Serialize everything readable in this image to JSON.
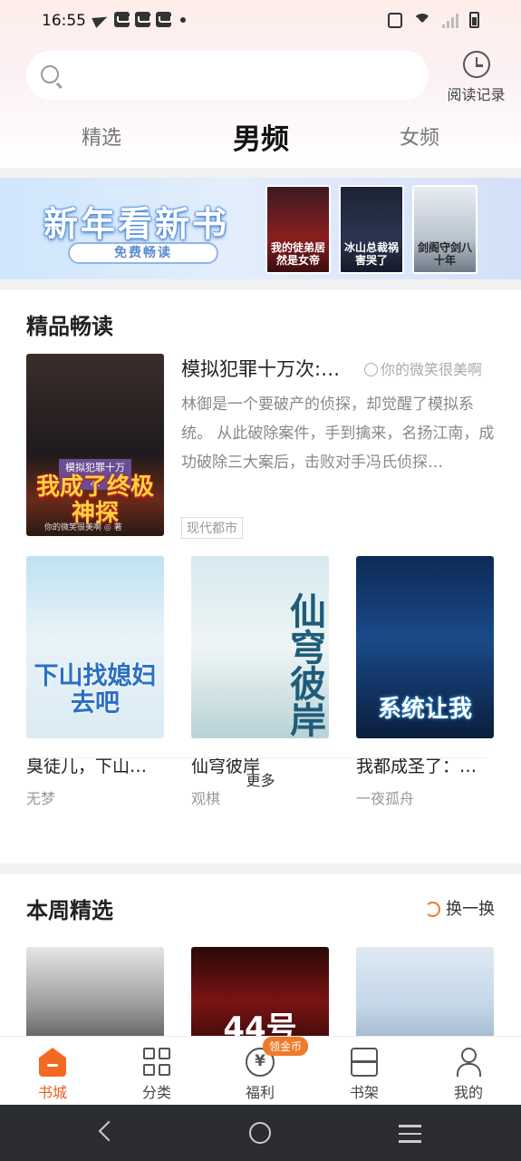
{
  "status": {
    "time": "16:55"
  },
  "search": {
    "placeholder": ""
  },
  "history": {
    "label": "阅读记录"
  },
  "tabs": [
    {
      "label": "精选",
      "active": false
    },
    {
      "label": "男频",
      "active": true
    },
    {
      "label": "女频",
      "active": false
    }
  ],
  "banner": {
    "title": "新年看新书",
    "button": "免费畅读",
    "covers": [
      "我的徒弟居然是女帝",
      "冰山总裁祸害哭了",
      "剑阁守剑八十年"
    ]
  },
  "featured": {
    "section_title": "精品畅读",
    "main": {
      "title": "模拟犯罪十万次:…",
      "author": "你的微笑很美啊",
      "description": "林御是一个要破产的侦探，却觉醒了模拟系统。      从此破除案件，手到擒来，名扬江南，成功破除三大案后，击败对手冯氏侦探…",
      "tag": "现代都市",
      "cover_line1": "模拟犯罪十万次",
      "cover_line2": "我成了终极神探",
      "cover_line3": "你的微笑很美啊 ◎ 著"
    },
    "books": [
      {
        "title": "臭徒儿，下山…",
        "author": "无梦",
        "cover_text": "下山找媳妇去吧"
      },
      {
        "title": "仙穹彼岸",
        "author": "观棋",
        "cover_text": "仙穹彼岸"
      },
      {
        "title": "我都成圣了：…",
        "author": "一夜孤舟",
        "cover_text": "系统让我"
      }
    ],
    "more_label": "更多"
  },
  "weekly": {
    "section_title": "本周精选",
    "refresh_label": "换一换",
    "cover_text_2": "44号"
  },
  "bottom_nav": [
    {
      "label": "书城",
      "icon": "bookstore-icon",
      "active": true
    },
    {
      "label": "分类",
      "icon": "category-icon",
      "active": false
    },
    {
      "label": "福利",
      "icon": "yen-coin-icon",
      "active": false
    },
    {
      "label": "书架",
      "icon": "bookshelf-icon",
      "active": false
    },
    {
      "label": "我的",
      "icon": "profile-icon",
      "active": false
    }
  ],
  "coin_badge": "领金币",
  "colors": {
    "accent": "#f26a22",
    "banner_bg": "#d3e0f7",
    "text_primary": "#222222",
    "text_secondary": "#999999"
  }
}
